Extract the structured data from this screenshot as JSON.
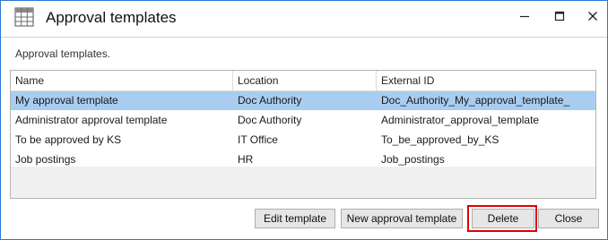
{
  "window": {
    "title": "Approval templates",
    "description": "Approval templates."
  },
  "grid": {
    "columns": [
      "Name",
      "Location",
      "External ID"
    ],
    "rows": [
      {
        "name": "My approval template",
        "location": "Doc Authority",
        "external_id": "Doc_Authority_My_approval_template_",
        "selected": true
      },
      {
        "name": "Administrator approval template",
        "location": "Doc Authority",
        "external_id": "Administrator_approval_template",
        "selected": false
      },
      {
        "name": "To be approved by KS",
        "location": "IT Office",
        "external_id": "To_be_approved_by_KS",
        "selected": false
      },
      {
        "name": "Job postings",
        "location": "HR",
        "external_id": "Job_postings",
        "selected": false
      }
    ]
  },
  "buttons": {
    "edit_template": "Edit template",
    "new_approval_template": "New approval template",
    "delete": "Delete",
    "close": "Close"
  },
  "colors": {
    "selected_row": "#a9cdf0",
    "window_border": "#2b78d4",
    "highlight": "#e00000"
  },
  "icons": {
    "app": "table-grid-icon",
    "minimize": "minimize-icon",
    "maximize": "maximize-icon",
    "close": "close-icon"
  }
}
